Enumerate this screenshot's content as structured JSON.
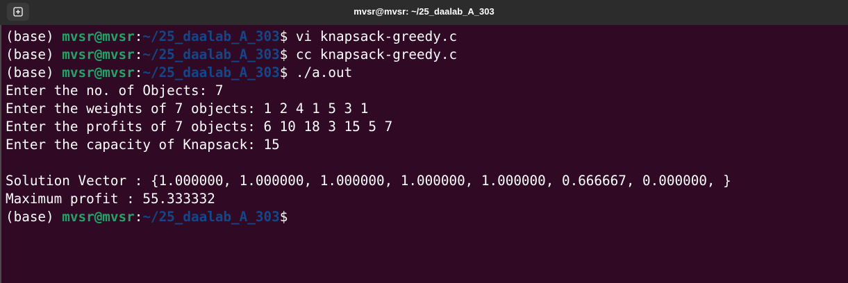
{
  "window": {
    "title": "mvsr@mvsr: ~/25_daalab_A_303"
  },
  "titlebar": {
    "new_tab_icon": "new-tab-icon"
  },
  "colors": {
    "background": "#300a24",
    "titlebar": "#2c2c2c",
    "user_host": "#26a269",
    "path": "#12488b",
    "text": "#ffffff"
  },
  "prompt": {
    "env": "(base) ",
    "user_host": "mvsr@mvsr",
    "colon": ":",
    "path": "~/25_daalab_A_303",
    "dollar": "$"
  },
  "commands": [
    " vi knapsack-greedy.c",
    " cc knapsack-greedy.c",
    " ./a.out"
  ],
  "output": [
    "Enter the no. of Objects: 7",
    "Enter the weights of 7 objects: 1 2 4 1 5 3 1",
    "Enter the profits of 7 objects: 6 10 18 3 15 5 7",
    "Enter the capacity of Knapsack: 15",
    "",
    "Solution Vector : {1.000000, 1.000000, 1.000000, 1.000000, 1.000000, 0.666667, 0.000000, }",
    "Maximum profit : 55.333332"
  ]
}
